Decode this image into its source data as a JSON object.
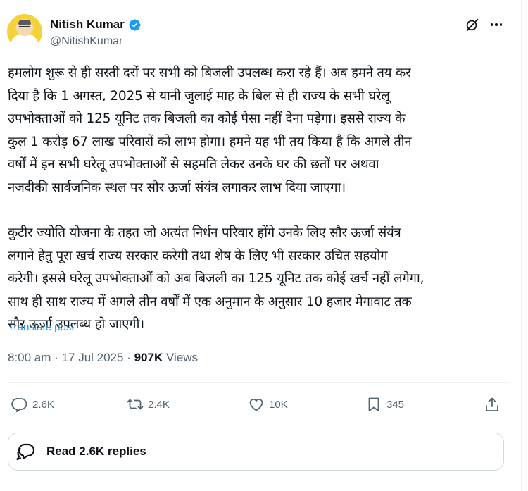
{
  "author": {
    "name": "Nitish Kumar",
    "handle": "@NitishKumar",
    "verified": true,
    "verified_color": "#1d9bf0"
  },
  "post": {
    "paragraphs": [
      "हमलोग शुरू से ही सस्ती दरों पर सभी को बिजली उपलब्ध करा रहे हैं। अब हमने तय कर\nदिया है कि 1 अगस्त, 2025 से यानी जुलाई माह के बिल से ही राज्य के सभी घरेलू\nउपभोक्ताओं को 125 यूनिट तक बिजली का कोई पैसा नहीं देना पड़ेगा। इससे राज्य के\nकुल 1 करोड़ 67 लाख परिवारों को लाभ होगा। हमने यह भी तय किया है कि अगले तीन\nवर्षों में इन सभी घरेलू उपभोक्ताओं से सहमति लेकर उनके घर की छतों पर अथवा\nनजदीकी सार्वजनिक स्थल पर सौर ऊर्जा संयंत्र लगाकर लाभ दिया जाएगा।",
      "कुटीर ज्योति योजना के तहत जो अत्यंत निर्धन परिवार होंगे उनके लिए सौर ऊर्जा संयंत्र\nलगाने हेतु पूरा खर्च राज्य सरकार करेगी तथा शेष के लिए भी सरकार उचित सहयोग\nकरेगी। इससे घरेलू उपभोक्ताओं को अब बिजली का 125 यूनिट तक कोई खर्च नहीं लगेगा,\nसाथ ही साथ राज्य में अगले तीन वर्षों में एक अनुमान के अनुसार 10 हजार मेगावाट तक\nसौर ऊर्जा उपलब्ध हो जाएगी।"
    ],
    "translate_label": "Translate post",
    "time": "8:00 am",
    "date": "17 Jul 2025",
    "views_count": "907K",
    "views_label": "Views"
  },
  "actions": {
    "replies": "2.6K",
    "reposts": "2.4K",
    "likes": "10K",
    "bookmarks": "345"
  },
  "read_replies_label": "Read 2.6K replies",
  "icons": {
    "grok": "grok-icon",
    "more": "more-icon",
    "reply": "reply-icon",
    "repost": "repost-icon",
    "like": "heart-icon",
    "bookmark": "bookmark-icon",
    "share": "share-icon",
    "replies_bubble": "replies-bubble-icon"
  },
  "colors": {
    "text": "#0f1419",
    "secondary": "#536471",
    "link": "#1d9bf0",
    "border": "#cfd9de"
  }
}
